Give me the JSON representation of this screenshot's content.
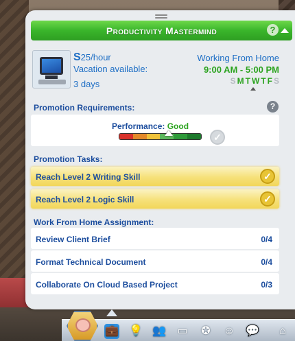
{
  "panel": {
    "title": "Productivity Mastermind",
    "help_glyph": "?"
  },
  "job": {
    "pay_currency": "S",
    "pay_rate": "25/hour",
    "vacation_label": "Vacation available:",
    "vacation_days": "3 days",
    "location": "Working From Home",
    "hours": "9:00  AM - 5:00  PM",
    "days": [
      {
        "letter": "S",
        "active": false
      },
      {
        "letter": "M",
        "active": true
      },
      {
        "letter": "T",
        "active": true
      },
      {
        "letter": "W",
        "active": true
      },
      {
        "letter": "T",
        "active": true
      },
      {
        "letter": "F",
        "active": true
      },
      {
        "letter": "S",
        "active": false
      }
    ]
  },
  "promotion": {
    "requirements_label": "Promotion Requirements:",
    "performance_label": "Performance:",
    "performance_value": "Good",
    "performance_level": 0.6,
    "help_glyph": "?",
    "tasks_label": "Promotion Tasks:",
    "tasks": [
      {
        "label": "Reach Level 2 Writing Skill",
        "done": true
      },
      {
        "label": "Reach Level 2 Logic Skill",
        "done": true
      }
    ]
  },
  "assignment": {
    "label": "Work From Home Assignment:",
    "items": [
      {
        "label": "Review Client Brief",
        "count": "0/4"
      },
      {
        "label": "Format Technical Document",
        "count": "0/4"
      },
      {
        "label": "Collaborate On Cloud Based Project",
        "count": "0/3"
      }
    ]
  },
  "colors": {
    "header_green": "#3ab52b",
    "text_blue": "#1d4e9e",
    "good_green": "#2ba31f",
    "task_gold": "#f2d65a",
    "perf_bar": [
      "#d8322b",
      "#e4892a",
      "#f0c23a",
      "#5cb85c",
      "#2e9a3a",
      "#1d7a2c"
    ]
  },
  "bottom_icons": [
    "career-icon",
    "lightbulb-icon",
    "relationships-icon",
    "inventory-icon",
    "aspiration-icon",
    "emotion-icon",
    "chat-icon",
    "build-mode-icon"
  ]
}
